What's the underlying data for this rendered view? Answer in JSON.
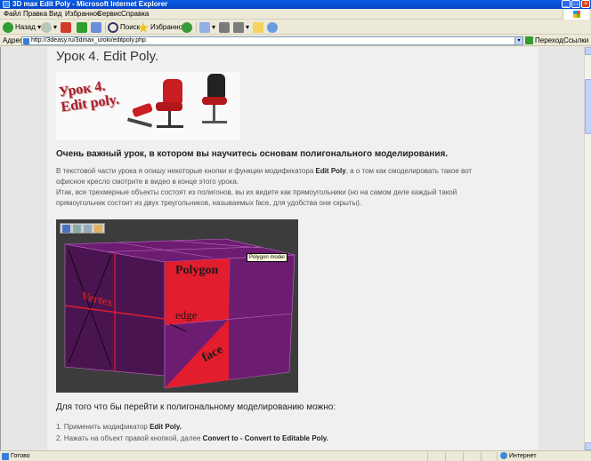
{
  "window": {
    "title": "3D max Edit Poly - Microsoft Internet Explorer"
  },
  "menu": [
    "Файл",
    "Правка",
    "Вид",
    "Избранное",
    "Сервис",
    "Справка"
  ],
  "toolbar": {
    "back": "Назад",
    "search": "Поиск",
    "favorites": "Избранное"
  },
  "address": {
    "label": "Адрес:",
    "url": "http://3deasy.ru/3dmax_uroki/editpoly.php",
    "go": "Переход",
    "links": "Ссылки"
  },
  "page": {
    "title": "Урок 4. Edit Poly.",
    "banner_text_line1": "Урок 4.",
    "banner_text_line2": "Edit poly.",
    "subheading": "Очень важный урок, в котором вы научитесь основам полигонального моделирования.",
    "p1_a": "В текстовой части урока я опишу некоторые кнопки и функции модификатора ",
    "p1_b": "Edit Poly",
    "p1_c": ", а о том как смоделировать такое вот",
    "p1_line2": "офисное кресло смотрите в видео в конце этого урока.",
    "p2_line1": "Итак, все трехмерные объекты состоят из полигонов, вы их видите как прямоугольники (но на самом деле каждый такой",
    "p2_line2": "прямоугольник состоит из двух треугольников, называемых face, для удобства они скрыты).",
    "figure": {
      "tooltip": "Polygon model",
      "label_polygon": "Polygon",
      "label_vertex": "Vertex",
      "label_edge": "edge",
      "label_face": "face"
    },
    "heading2": "Для того что бы перейти к полигональному моделированию можно:",
    "list": [
      {
        "prefix": "1. Применить модификатор ",
        "bold": "Edit Poly.",
        "suffix": ""
      },
      {
        "prefix": "2. Нажать на объект правой кнопкой, далее ",
        "bold": "Convert to - Convert to Editable Poly.",
        "suffix": ""
      }
    ]
  },
  "status": {
    "text": "Готово",
    "zone": "Интернет"
  }
}
